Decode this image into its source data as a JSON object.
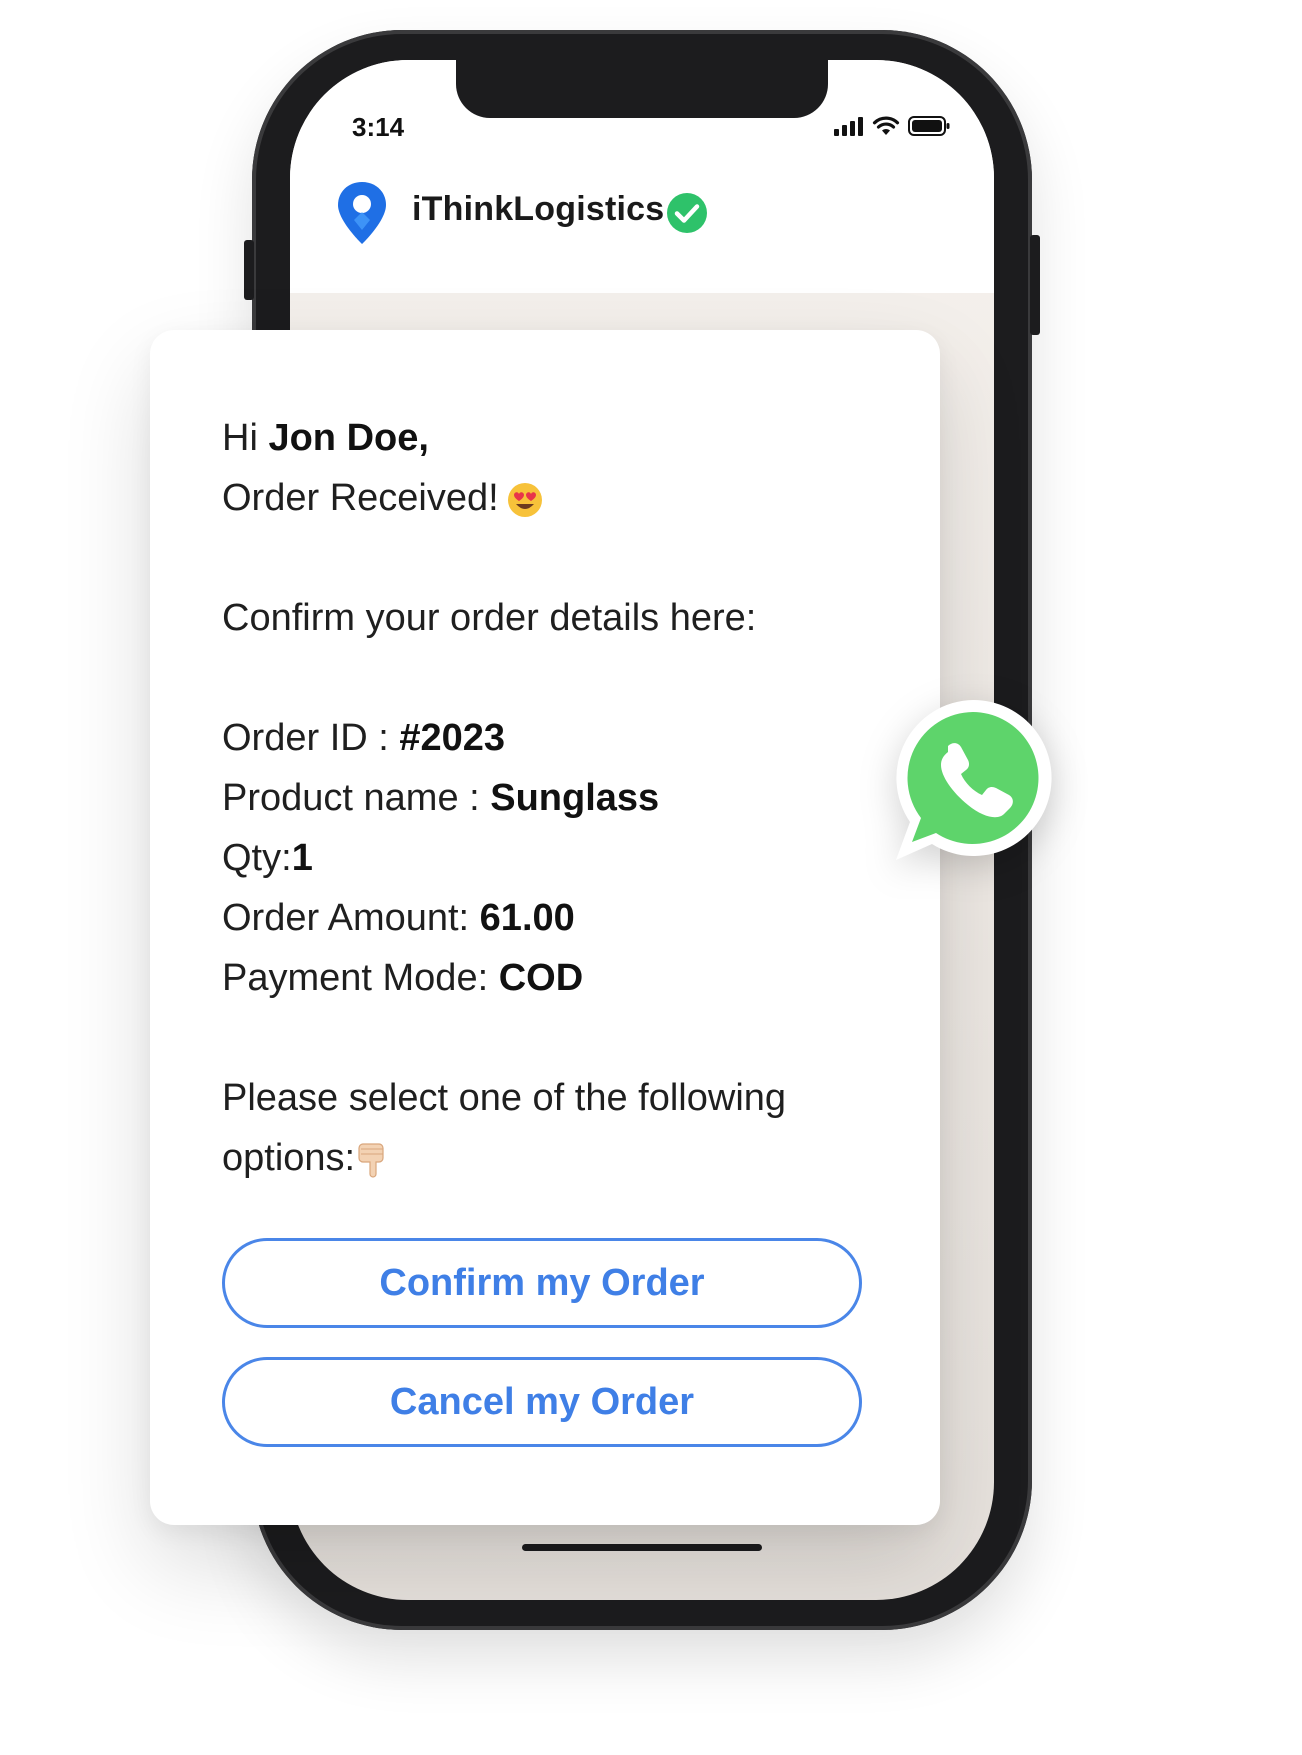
{
  "status_bar": {
    "time": "3:14"
  },
  "chat_header": {
    "brand_name": "iThinkLogistics",
    "verified_icon": "verified-check-icon"
  },
  "message": {
    "greeting_prefix": "Hi ",
    "customer_name": "Jon Doe,",
    "order_received": "Order Received!",
    "order_received_emoji": "heart-eyes-emoji",
    "confirm_prompt": "Confirm your order details here:",
    "order_id_label": "Order ID : ",
    "order_id": "#2023",
    "product_label": "Product name : ",
    "product_name": "Sunglass",
    "qty_label": "Qty:",
    "qty": "1",
    "amount_label": "Order Amount: ",
    "amount": "61.00",
    "payment_label": "Payment Mode: ",
    "payment_mode": "COD",
    "select_line1": "Please select one of the following",
    "select_line2": "options:",
    "select_emoji": "pointing-down-emoji"
  },
  "actions": {
    "confirm_label": "Confirm my Order",
    "cancel_label": "Cancel my Order"
  },
  "colors": {
    "button_blue": "#3f7fe6",
    "whatsapp_green": "#5ed46b",
    "verified_green": "#2ec26a",
    "logo_blue": "#1f6fe5"
  }
}
